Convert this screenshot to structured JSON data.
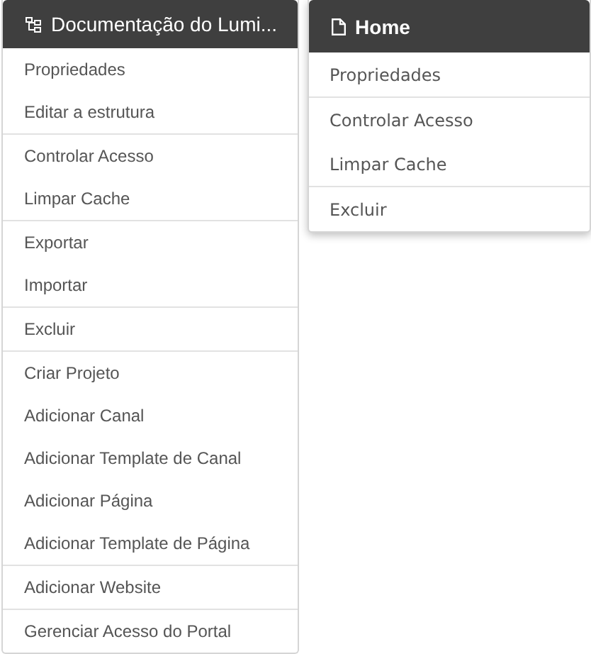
{
  "menus": [
    {
      "title": "Documentação do Lumi...",
      "kind": "structure",
      "groups": [
        [
          "Propriedades",
          "Editar a estrutura"
        ],
        [
          "Controlar Acesso",
          "Limpar Cache"
        ],
        [
          "Exportar",
          "Importar"
        ],
        [
          "Excluir"
        ],
        [
          "Criar Projeto",
          "Adicionar Canal",
          "Adicionar Template de Canal",
          "Adicionar Página",
          "Adicionar Template de Página"
        ],
        [
          "Adicionar Website"
        ],
        [
          "Gerenciar Acesso do Portal"
        ]
      ]
    },
    {
      "title": "Home",
      "kind": "page",
      "groups": [
        [
          "Propriedades"
        ],
        [
          "Controlar Acesso",
          "Limpar Cache"
        ],
        [
          "Excluir"
        ]
      ]
    }
  ]
}
